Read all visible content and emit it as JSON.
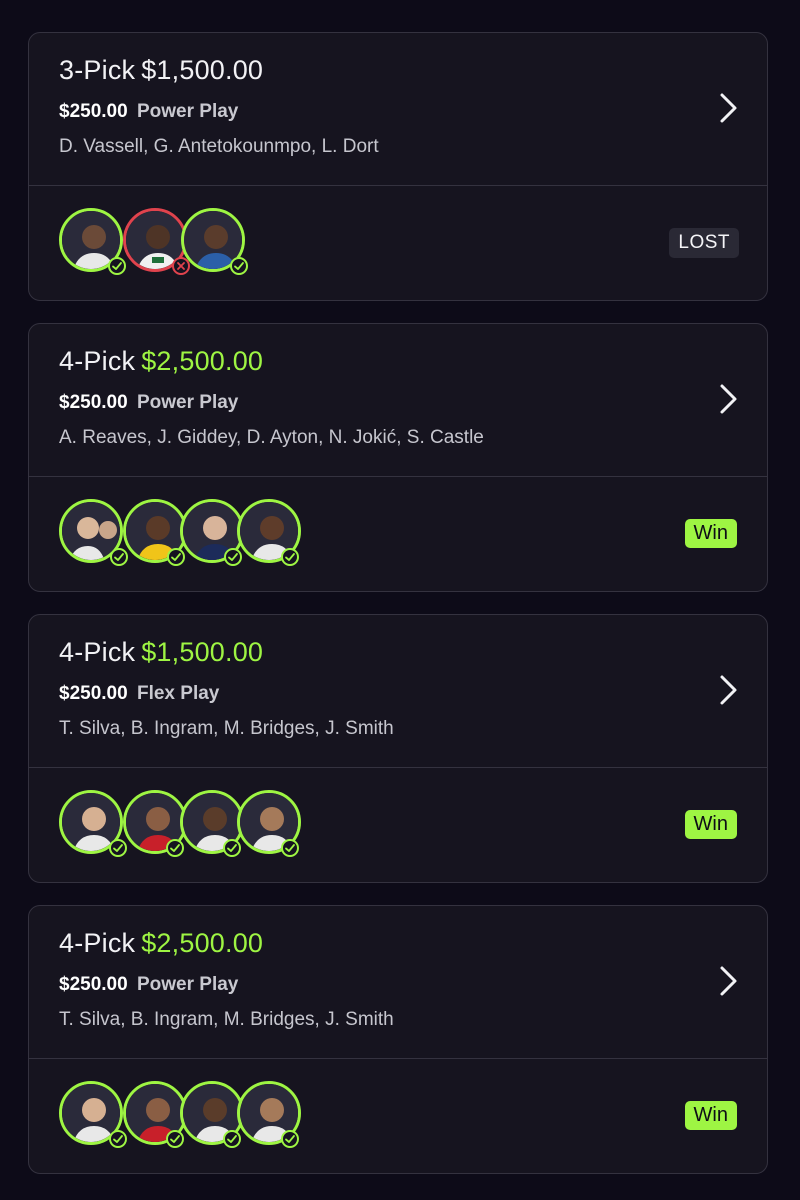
{
  "colors": {
    "background": "#0d0b18",
    "card": "#16141f",
    "accent_green": "#9ef543",
    "loss_red": "#e0434d",
    "text_primary": "#f2f2f5",
    "text_secondary": "#c6c6ce"
  },
  "cards": [
    {
      "pick_label": "3-Pick",
      "payout": "$1,500.00",
      "payout_color": "#f2f2f5",
      "entry_amount": "$250.00",
      "play_type": "Power Play",
      "players": "D. Vassell, G. Antetokounmpo, L. Dort",
      "status": "LOST",
      "picks": [
        "hit",
        "miss",
        "hit"
      ]
    },
    {
      "pick_label": "4-Pick",
      "payout": "$2,500.00",
      "payout_color": "#9ef543",
      "entry_amount": "$250.00",
      "play_type": "Power Play",
      "players": "A. Reaves, J. Giddey, D. Ayton, N. Jokić, S. Castle",
      "status": "Win",
      "picks": [
        "hit",
        "hit",
        "hit",
        "hit"
      ]
    },
    {
      "pick_label": "4-Pick",
      "payout": "$1,500.00",
      "payout_color": "#9ef543",
      "entry_amount": "$250.00",
      "play_type": "Flex Play",
      "players": "T. Silva, B. Ingram, M. Bridges, J. Smith",
      "status": "Win",
      "picks": [
        "hit",
        "hit",
        "hit",
        "hit"
      ]
    },
    {
      "pick_label": "4-Pick",
      "payout": "$2,500.00",
      "payout_color": "#9ef543",
      "entry_amount": "$250.00",
      "play_type": "Power Play",
      "players": "T. Silva, B. Ingram, M. Bridges, J. Smith",
      "status": "Win",
      "picks": [
        "hit",
        "hit",
        "hit",
        "hit"
      ]
    }
  ],
  "icons": {
    "chevron": "chevron-right-icon",
    "hit": "check-icon",
    "miss": "x-icon"
  }
}
